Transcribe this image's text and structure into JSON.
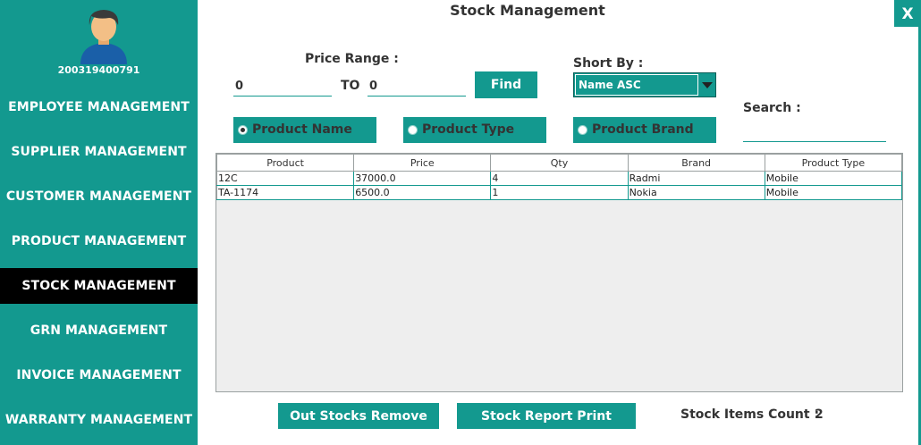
{
  "window": {
    "title": "Stock Management",
    "close_label": "X"
  },
  "user": {
    "id": "200319400791"
  },
  "sidebar": {
    "items": [
      {
        "label": "EMPLOYEE MANAGEMENT"
      },
      {
        "label": "SUPPLIER MANAGEMENT"
      },
      {
        "label": "CUSTOMER MANAGEMENT"
      },
      {
        "label": "PRODUCT MANAGEMENT"
      },
      {
        "label": "STOCK MANAGEMENT",
        "active": true
      },
      {
        "label": "GRN MANAGEMENT"
      },
      {
        "label": "INVOICE MANAGEMENT"
      },
      {
        "label": "WARRANTY MANAGEMENT"
      }
    ]
  },
  "filters": {
    "price_range_label": "Price Range :",
    "price_min": "0",
    "to_label": "TO",
    "price_max": "0",
    "find_label": "Find",
    "sort_label": "Short By  :",
    "sort_value": "Name ASC",
    "search_label": "Search :",
    "search_value": "",
    "radios": [
      {
        "label": "Product Name",
        "selected": true
      },
      {
        "label": "Product Type",
        "selected": false
      },
      {
        "label": "Product Brand",
        "selected": false
      }
    ]
  },
  "table": {
    "columns": [
      "Product",
      "Price",
      "Qty",
      "Brand",
      "Product Type"
    ],
    "rows": [
      [
        "12C",
        "37000.0",
        "4",
        "Radmi",
        "Mobile"
      ],
      [
        "TA-1174",
        "6500.0",
        "1",
        "Nokia",
        "Mobile"
      ]
    ]
  },
  "footer": {
    "remove_label": "Out Stocks Remove",
    "print_label": "Stock Report Print",
    "count_label": "Stock Items Count :",
    "count_value": "2"
  },
  "colors": {
    "accent": "#13998f",
    "active_nav": "#000000",
    "text": "#333333"
  }
}
